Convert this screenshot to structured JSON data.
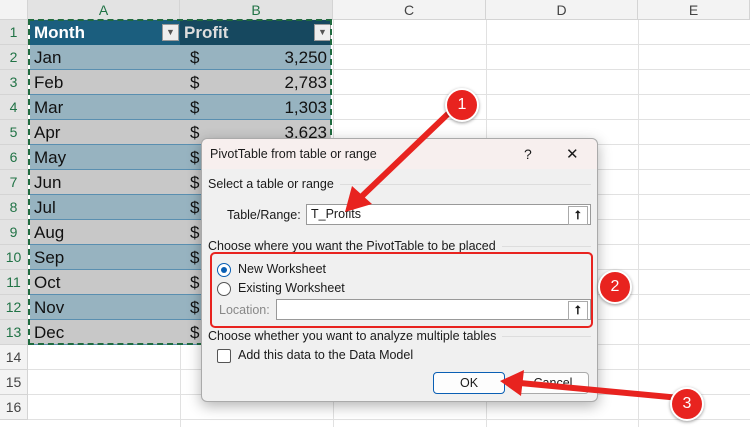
{
  "columns": [
    "A",
    "B",
    "C",
    "D",
    "E"
  ],
  "rows": [
    "1",
    "2",
    "3",
    "4",
    "5",
    "6",
    "7",
    "8",
    "9",
    "10",
    "11",
    "12",
    "13",
    "14",
    "15",
    "16"
  ],
  "table": {
    "headers": [
      "Month",
      "Profit"
    ],
    "months": [
      "Jan",
      "Feb",
      "Mar",
      "Apr",
      "May",
      "Jun",
      "Jul",
      "Aug",
      "Sep",
      "Oct",
      "Nov",
      "Dec"
    ],
    "currency": "$",
    "profits": [
      "3,250",
      "2,783",
      "1,303",
      "3,623"
    ]
  },
  "dialog": {
    "title": "PivotTable from table or range",
    "help": "?",
    "close": "✕",
    "section1": "Select a table or range",
    "range_label": "Table/Range:",
    "range_value": "T_Profits",
    "section2": "Choose where you want the PivotTable to be placed",
    "opt_new": "New Worksheet",
    "opt_existing": "Existing Worksheet",
    "location_label": "Location:",
    "location_value": "",
    "section3": "Choose whether you want to analyze multiple tables",
    "data_model": "Add this data to the Data Model",
    "ok": "OK",
    "cancel": "Cancel",
    "up_icon": "⭡"
  },
  "annotations": [
    "1",
    "2",
    "3"
  ],
  "colors": {
    "header": "#1b5e7e",
    "band1": "#97b3c0",
    "band2": "#c8c8c8",
    "callout": "#e8231f"
  }
}
